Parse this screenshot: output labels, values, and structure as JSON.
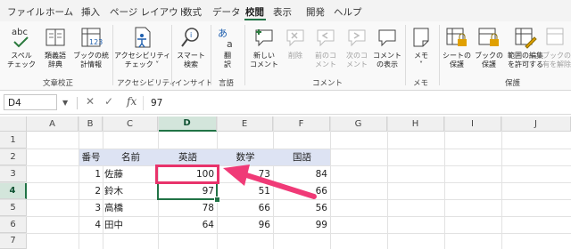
{
  "tabs": [
    "ファイル",
    "ホーム",
    "挿入",
    "ページ レイアウト",
    "数式",
    "データ",
    "校閲",
    "表示",
    "開発",
    "ヘルプ"
  ],
  "active_tab": "校閲",
  "ribbon": {
    "groups": [
      {
        "label": "文章校正",
        "items": [
          {
            "label": "スペル\nチェック",
            "icon": "abc-check-icon"
          },
          {
            "label": "類義語\n辞典",
            "icon": "thesaurus-book-icon"
          },
          {
            "label": "ブックの統\n計情報",
            "icon": "workbook-statistics-icon"
          }
        ]
      },
      {
        "label": "アクセシビリティ",
        "items": [
          {
            "label": "アクセシビリティ\nチェック ˅",
            "icon": "accessibility-check-icon"
          }
        ]
      },
      {
        "label": "インサイト",
        "items": [
          {
            "label": "スマート\n検索",
            "icon": "smart-lookup-icon"
          }
        ]
      },
      {
        "label": "言語",
        "items": [
          {
            "label": "翻\n訳",
            "icon": "translate-icon"
          }
        ]
      },
      {
        "label": "コメント",
        "items": [
          {
            "label": "新しい\nコメント",
            "icon": "new-comment-icon"
          },
          {
            "label": "削除",
            "icon": "delete-comment-icon",
            "disabled": true
          },
          {
            "label": "前のコ\nメント",
            "icon": "previous-comment-icon",
            "disabled": true
          },
          {
            "label": "次のコ\nメント",
            "icon": "next-comment-icon",
            "disabled": true
          },
          {
            "label": "コメント\nの表示",
            "icon": "show-comments-icon"
          }
        ]
      },
      {
        "label": "メモ",
        "items": [
          {
            "label": "メモ\n˅",
            "icon": "notes-icon"
          }
        ]
      },
      {
        "label": "保護",
        "items": [
          {
            "label": "シートの\n保護",
            "icon": "protect-sheet-icon"
          },
          {
            "label": "ブックの\n保護",
            "icon": "protect-workbook-icon"
          },
          {
            "label": "範囲の編集\nを許可する",
            "icon": "allow-edit-ranges-icon"
          },
          {
            "label": "ブックの\n有を解除",
            "icon": "unshare-workbook-icon",
            "disabled": true
          }
        ]
      }
    ]
  },
  "formula_bar": {
    "name_box": "D4",
    "formula": "97",
    "icons": [
      "cancel-icon",
      "enter-check-icon",
      "fx-icon"
    ],
    "fx_label": "fx"
  },
  "columns": [
    "A",
    "B",
    "C",
    "D",
    "E",
    "F",
    "G",
    "H",
    "I",
    "J"
  ],
  "selected_column": "D",
  "rows": [
    "1",
    "2",
    "3",
    "4",
    "5",
    "6",
    "7"
  ],
  "selected_row": "4",
  "table": {
    "headers": [
      "番号",
      "名前",
      "英語",
      "数学",
      "国語"
    ],
    "records": [
      [
        "1",
        "佐藤",
        "100",
        "73",
        "84"
      ],
      [
        "2",
        "鈴木",
        "97",
        "51",
        "66"
      ],
      [
        "3",
        "高橋",
        "78",
        "66",
        "56"
      ],
      [
        "4",
        "田中",
        "64",
        "96",
        "99"
      ]
    ]
  },
  "highlight": {
    "box_color": "#e8336b",
    "arrow_color": "#f03a77"
  },
  "colors": {
    "accent": "#217346",
    "table_header_bg": "#dde3f3"
  }
}
